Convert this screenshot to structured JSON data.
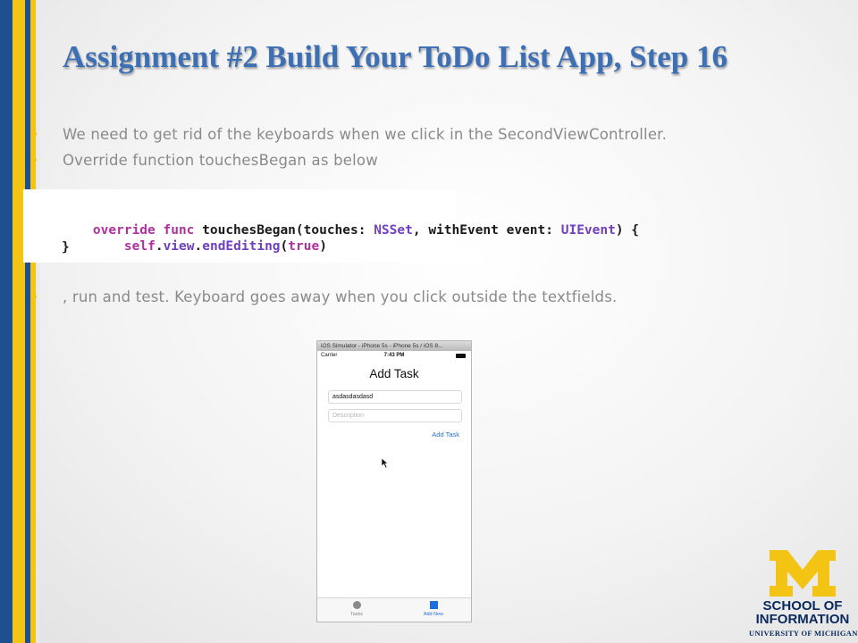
{
  "slide": {
    "title": "Assignment #2 Build Your ToDo List App, Step 16",
    "bullets": [
      "We need to get rid of the keyboards when we click in the SecondViewController.",
      "Override function touchesBegan as below",
      ", run and test.  Keyboard goes away when you click outside the textfields."
    ]
  },
  "code": {
    "line1": [
      {
        "text": "override func ",
        "kind": "keyword"
      },
      {
        "text": "touchesBegan(touches: ",
        "kind": "plain"
      },
      {
        "text": "NSSet",
        "kind": "type"
      },
      {
        "text": ", withEvent event: ",
        "kind": "plain"
      },
      {
        "text": "UIEvent",
        "kind": "type"
      },
      {
        "text": ") {",
        "kind": "plain"
      }
    ],
    "line2": [
      {
        "text": "self",
        "kind": "keyword"
      },
      {
        "text": ".",
        "kind": "plain"
      },
      {
        "text": "view",
        "kind": "type"
      },
      {
        "text": ".",
        "kind": "plain"
      },
      {
        "text": "endEditing",
        "kind": "type"
      },
      {
        "text": "(",
        "kind": "plain"
      },
      {
        "text": "true",
        "kind": "keyword"
      },
      {
        "text": ")",
        "kind": "plain"
      }
    ],
    "line3": "}"
  },
  "simulator": {
    "window_title": "iOS Simulator - iPhone 5s - iPhone 5s / iOS 8...",
    "carrier": "Carrier",
    "time": "7:43 PM",
    "nav_title": "Add Task",
    "task_field_value": "asdasdasdasd",
    "description_placeholder": "Description",
    "add_task_button": "Add Task",
    "tabs": [
      {
        "label": "Tasks",
        "icon": "circle-icon"
      },
      {
        "label": "Add New",
        "icon": "square-icon"
      }
    ]
  },
  "logo": {
    "line1": "SCHOOL OF",
    "line2": "INFORMATION",
    "line3": "UNIVERSITY OF MICHIGAN"
  },
  "colors": {
    "title": "#3d6fb5",
    "stripe_blue": "#1f4f8f",
    "stripe_gold": "#f4c414",
    "bullet_text": "#8a8a8a",
    "code_keyword": "#b0309e",
    "code_type": "#6f41c1",
    "ios_tint": "#2a6fdb",
    "michigan_navy": "#0a2a5c",
    "michigan_maize": "#f4c414"
  }
}
